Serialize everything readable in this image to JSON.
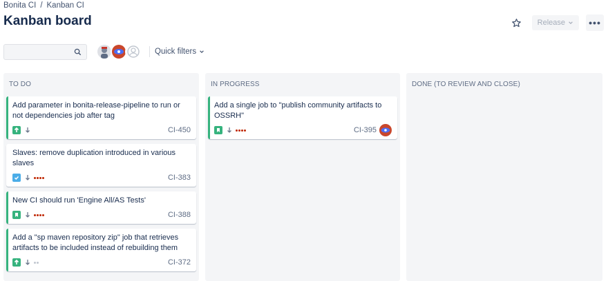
{
  "breadcrumb": {
    "project": "Bonita CI",
    "separator": "/",
    "board": "Kanban CI"
  },
  "page": {
    "title": "Kanban board"
  },
  "header": {
    "release_label": "Release"
  },
  "toolbar": {
    "search_placeholder": "",
    "quick_filters_label": "Quick filters"
  },
  "colors": {
    "green_edge": "#36b37e",
    "story": "#36b37e",
    "task": "#4bade8",
    "priority_dots": "#bf2600"
  },
  "columns": [
    {
      "title": "To Do",
      "cards": [
        {
          "summary": "Add parameter in bonita-release-pipeline to run or not dependencies job after tag",
          "key": "CI-450",
          "type": "improvement-icon",
          "priority": "low-priority-icon",
          "dots": 0,
          "accent": true
        },
        {
          "summary": "Slaves: remove duplication introduced in various slaves",
          "key": "CI-383",
          "type": "task-icon",
          "priority": "low-priority-icon",
          "dots": 4,
          "accent": false
        },
        {
          "summary": "New CI should run 'Engine All/AS Tests'",
          "key": "CI-388",
          "type": "story-icon",
          "priority": "low-priority-icon",
          "dots": 4,
          "accent": true
        },
        {
          "summary": "Add a \"sp maven repository zip\" job that retrieves artifacts to be included instead of rebuilding them",
          "key": "CI-372",
          "type": "improvement-icon",
          "priority": "low-priority-icon",
          "dots": 2,
          "accent": true
        }
      ]
    },
    {
      "title": "In Progress",
      "cards": [
        {
          "summary": "Add a single job to \"publish community artifacts to OSSRH\"",
          "key": "CI-395",
          "type": "story-icon",
          "priority": "low-priority-icon",
          "dots": 4,
          "accent": true
        }
      ]
    },
    {
      "title": "Done (to review and close)",
      "cards": []
    }
  ]
}
